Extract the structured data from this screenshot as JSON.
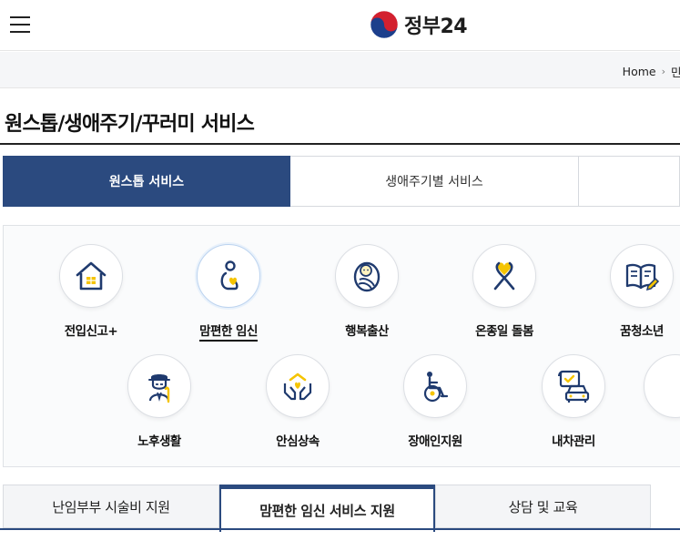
{
  "header": {
    "logo_text": "정부24",
    "menu_icon": "hamburger-menu-icon",
    "logo_icon": "taegeuk-emblem-icon"
  },
  "breadcrumb": {
    "home": "Home",
    "next": "민"
  },
  "page": {
    "title": "원스톱/생애주기/꾸러미 서비스"
  },
  "tabs": [
    {
      "label": "원스톱 서비스",
      "active": true
    },
    {
      "label": "생애주기별 서비스",
      "active": false
    },
    {
      "label": "",
      "active": false
    }
  ],
  "services": [
    {
      "label": "전입신고+",
      "icon": "house-icon"
    },
    {
      "label": "맘편한 임신",
      "icon": "pregnancy-icon",
      "selected": true
    },
    {
      "label": "행복출산",
      "icon": "baby-icon"
    },
    {
      "label": "온종일 돌봄",
      "icon": "ribbon-heart-icon"
    },
    {
      "label": "꿈청소년",
      "icon": "book-pencil-icon"
    },
    {
      "label": "노후생활",
      "icon": "elder-icon"
    },
    {
      "label": "안심상속",
      "icon": "hands-house-icon"
    },
    {
      "label": "장애인지원",
      "icon": "wheelchair-icon"
    },
    {
      "label": "내차관리",
      "icon": "car-document-icon"
    }
  ],
  "sub_tabs": [
    {
      "label": "난임부부 시술비 지원",
      "active": false
    },
    {
      "label": "맘편한 임신 서비스 지원",
      "active": true
    },
    {
      "label": "상담 및 교육",
      "active": false
    }
  ],
  "colors": {
    "primary": "#2b4a7f",
    "accent_yellow": "#f5c400",
    "icon_navy": "#1f3a6e"
  }
}
